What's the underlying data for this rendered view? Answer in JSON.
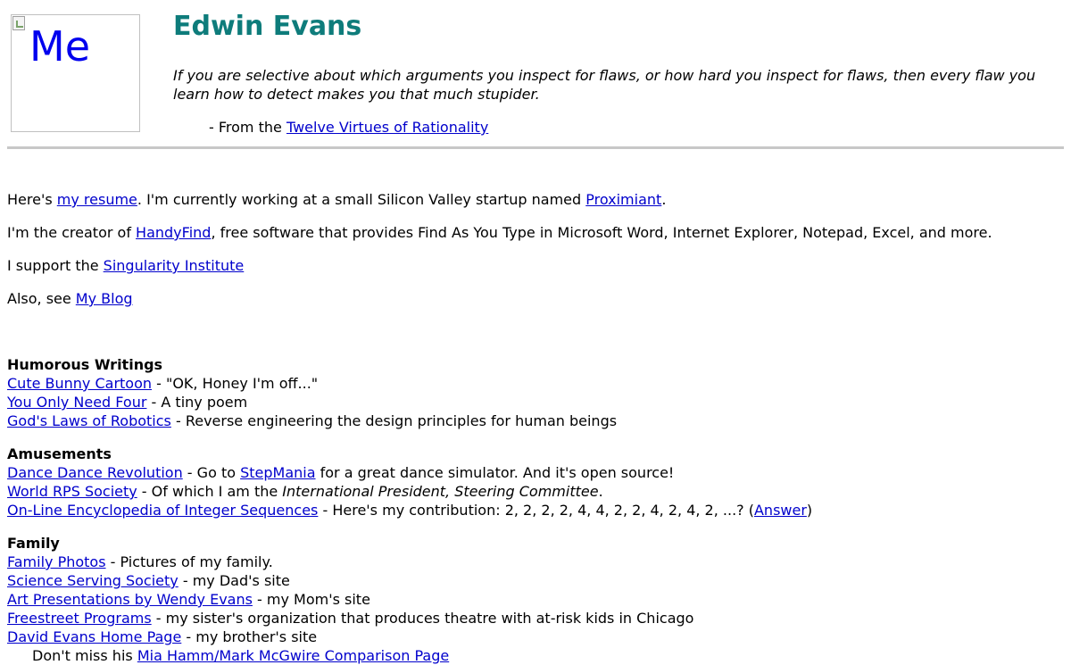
{
  "photo": {
    "alt": "Me"
  },
  "header": {
    "title": "Edwin Evans",
    "quote": "If you are selective about which arguments you inspect for flaws, or how hard you inspect for flaws, then every flaw you learn how to detect makes you that much stupider.",
    "attrib_prefix": "- From the ",
    "attrib_link": "Twelve Virtues of Rationality"
  },
  "intro": {
    "p1_a": "Here's ",
    "p1_link1": "my resume",
    "p1_b": ". I'm currently working at a small Silicon Valley startup named ",
    "p1_link2": "Proximiant",
    "p1_c": ".",
    "p2_a": "I'm the creator of ",
    "p2_link": "HandyFind",
    "p2_b": ", free software that provides Find As You Type in Microsoft Word, Internet Explorer, Notepad, Excel, and more.",
    "p3_a": "I support the ",
    "p3_link": "Singularity Institute",
    "p4_a": "Also, see ",
    "p4_link": "My Blog"
  },
  "humorous": {
    "heading": "Humorous Writings",
    "items": [
      {
        "link": "Cute Bunny Cartoon",
        "desc": " - \"OK, Honey I'm off...\""
      },
      {
        "link": "You Only Need Four",
        "desc": " - A tiny poem"
      },
      {
        "link": "God's Laws of Robotics",
        "desc": " - Reverse engineering the design principles for human beings"
      }
    ]
  },
  "amusements": {
    "heading": "Amusements",
    "ddr_link": "Dance Dance Revolution",
    "ddr_a": " - Go to ",
    "ddr_link2": "StepMania",
    "ddr_b": " for a great dance simulator. And it's open source!",
    "rps_link": "World RPS Society",
    "rps_a": " - Of which I am the ",
    "rps_title": "International President, Steering Committee",
    "rps_b": ".",
    "oeis_link": "On-Line Encyclopedia of Integer Sequences",
    "oeis_a": " - Here's my contribution: 2, 2, 2, 2, 4, 4, 2, 2, 4, 2, 4, 2, ...? (",
    "oeis_link2": "Answer",
    "oeis_b": ")"
  },
  "family": {
    "heading": "Family",
    "items": [
      {
        "link": "Family Photos",
        "desc": " - Pictures of my family."
      },
      {
        "link": "Science Serving Society",
        "desc": " - my Dad's site"
      },
      {
        "link": "Art Presentations by Wendy Evans",
        "desc": " - my Mom's site"
      },
      {
        "link": "Freestreet Programs",
        "desc": " - my sister's organization that produces theatre with at-risk kids in Chicago"
      },
      {
        "link": "David Evans Home Page",
        "desc": " - my brother's site"
      }
    ],
    "extra_a": "Don't miss his ",
    "extra_link": "Mia Hamm/Mark McGwire Comparison Page"
  }
}
